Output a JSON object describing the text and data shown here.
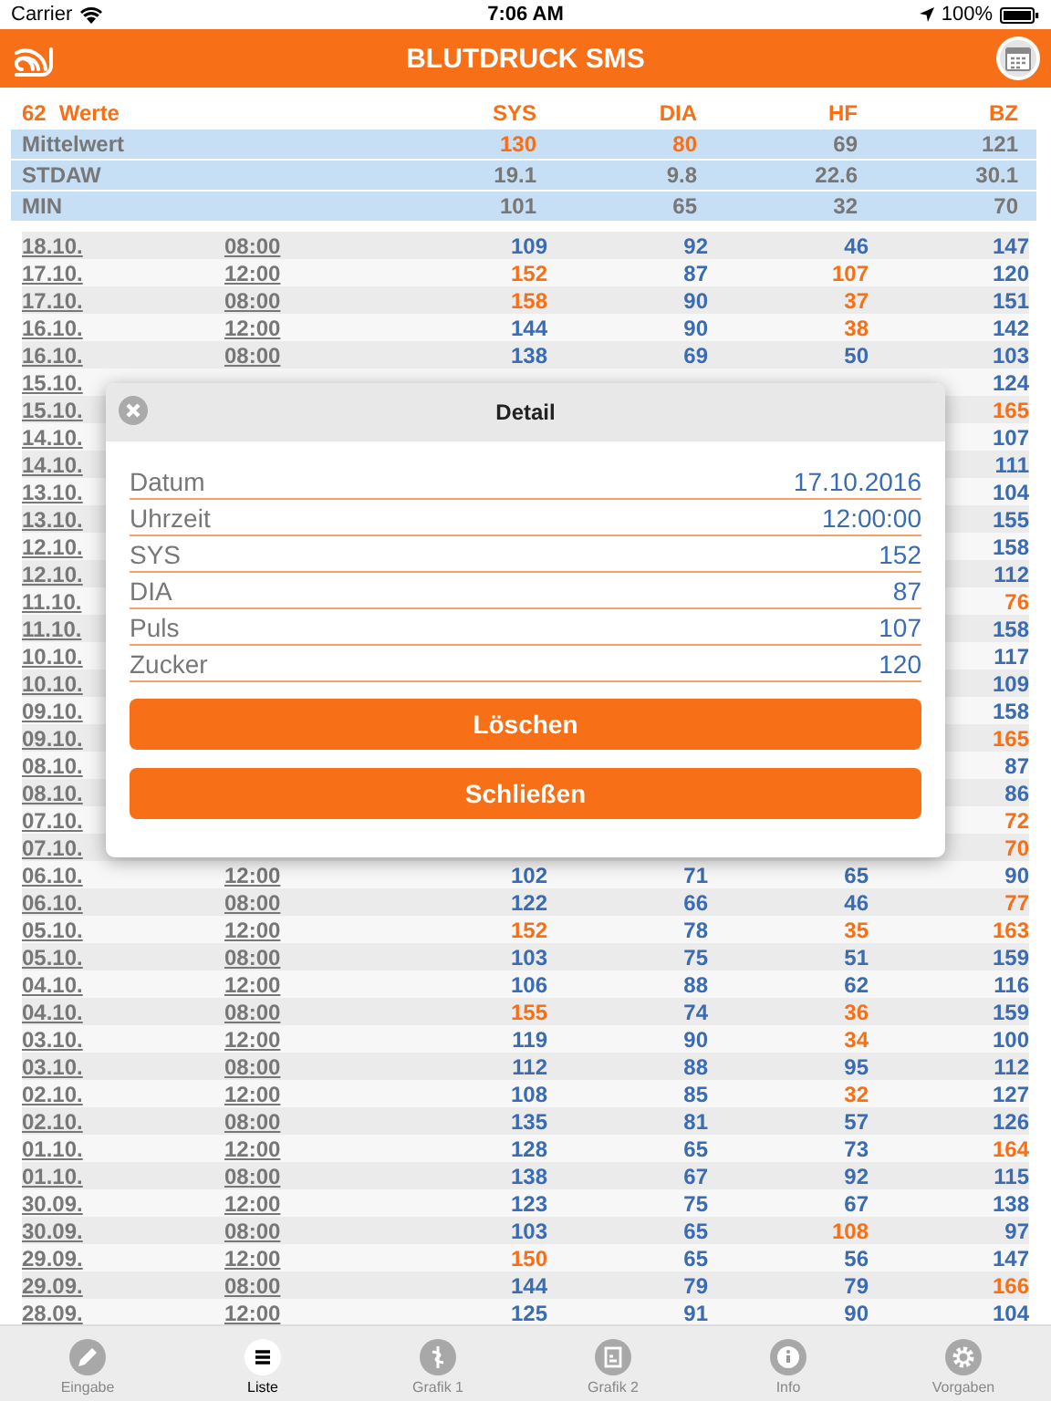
{
  "status_bar": {
    "carrier": "Carrier",
    "time": "7:06 AM",
    "battery": "100%"
  },
  "header": {
    "title": "BLUTDRUCK SMS"
  },
  "summary": {
    "count": "62",
    "count_label": "Werte",
    "columns": [
      "SYS",
      "DIA",
      "HF",
      "BZ"
    ],
    "rows": [
      {
        "label": "Mittelwert",
        "sys": {
          "text": "130",
          "alert": true
        },
        "dia": {
          "text": "80",
          "alert": true
        },
        "hf": {
          "text": "69",
          "alert": false
        },
        "bz": {
          "text": "121",
          "alert": false
        }
      },
      {
        "label": "STDAW",
        "sys": {
          "text": "19.1",
          "alert": false
        },
        "dia": {
          "text": "9.8",
          "alert": false
        },
        "hf": {
          "text": "22.6",
          "alert": false
        },
        "bz": {
          "text": "30.1",
          "alert": false
        }
      },
      {
        "label": "MIN",
        "sys": {
          "text": "101",
          "alert": false
        },
        "dia": {
          "text": "65",
          "alert": false
        },
        "hf": {
          "text": "32",
          "alert": false
        },
        "bz": {
          "text": "70",
          "alert": false
        }
      }
    ]
  },
  "rows": [
    {
      "date": "18.10.",
      "time": "08:00",
      "sys": {
        "text": "109",
        "alert": false
      },
      "dia": {
        "text": "92",
        "alert": false
      },
      "hf": {
        "text": "46",
        "alert": false
      },
      "bz": {
        "text": "147",
        "alert": false
      }
    },
    {
      "date": "17.10.",
      "time": "12:00",
      "sys": {
        "text": "152",
        "alert": true
      },
      "dia": {
        "text": "87",
        "alert": false
      },
      "hf": {
        "text": "107",
        "alert": true
      },
      "bz": {
        "text": "120",
        "alert": false
      }
    },
    {
      "date": "17.10.",
      "time": "08:00",
      "sys": {
        "text": "158",
        "alert": true
      },
      "dia": {
        "text": "90",
        "alert": false
      },
      "hf": {
        "text": "37",
        "alert": true
      },
      "bz": {
        "text": "151",
        "alert": false
      }
    },
    {
      "date": "16.10.",
      "time": "12:00",
      "sys": {
        "text": "144",
        "alert": false
      },
      "dia": {
        "text": "90",
        "alert": false
      },
      "hf": {
        "text": "38",
        "alert": true
      },
      "bz": {
        "text": "142",
        "alert": false
      }
    },
    {
      "date": "16.10.",
      "time": "08:00",
      "sys": {
        "text": "138",
        "alert": false
      },
      "dia": {
        "text": "69",
        "alert": false
      },
      "hf": {
        "text": "50",
        "alert": false
      },
      "bz": {
        "text": "103",
        "alert": false
      }
    },
    {
      "date": "15.10.",
      "bz": {
        "text": "124",
        "alert": false
      }
    },
    {
      "date": "15.10.",
      "bz": {
        "text": "165",
        "alert": true
      }
    },
    {
      "date": "14.10.",
      "bz": {
        "text": "107",
        "alert": false
      }
    },
    {
      "date": "14.10.",
      "bz": {
        "text": "111",
        "alert": false
      }
    },
    {
      "date": "13.10.",
      "bz": {
        "text": "104",
        "alert": false
      }
    },
    {
      "date": "13.10.",
      "bz": {
        "text": "155",
        "alert": false
      }
    },
    {
      "date": "12.10.",
      "bz": {
        "text": "158",
        "alert": false
      }
    },
    {
      "date": "12.10.",
      "bz": {
        "text": "112",
        "alert": false
      }
    },
    {
      "date": "11.10.",
      "bz": {
        "text": "76",
        "alert": true
      }
    },
    {
      "date": "11.10.",
      "bz": {
        "text": "158",
        "alert": false
      }
    },
    {
      "date": "10.10.",
      "bz": {
        "text": "117",
        "alert": false
      }
    },
    {
      "date": "10.10.",
      "bz": {
        "text": "109",
        "alert": false
      }
    },
    {
      "date": "09.10.",
      "bz": {
        "text": "158",
        "alert": false
      }
    },
    {
      "date": "09.10.",
      "bz": {
        "text": "165",
        "alert": true
      }
    },
    {
      "date": "08.10.",
      "bz": {
        "text": "87",
        "alert": false
      }
    },
    {
      "date": "08.10.",
      "bz": {
        "text": "86",
        "alert": false
      }
    },
    {
      "date": "07.10.",
      "bz": {
        "text": "72",
        "alert": true
      }
    },
    {
      "date": "07.10.",
      "bz": {
        "text": "70",
        "alert": true
      }
    },
    {
      "date": "06.10.",
      "time": "12:00",
      "sys": {
        "text": "102",
        "alert": false
      },
      "dia": {
        "text": "71",
        "alert": false
      },
      "hf": {
        "text": "65",
        "alert": false
      },
      "bz": {
        "text": "90",
        "alert": false
      }
    },
    {
      "date": "06.10.",
      "time": "08:00",
      "sys": {
        "text": "122",
        "alert": false
      },
      "dia": {
        "text": "66",
        "alert": false
      },
      "hf": {
        "text": "46",
        "alert": false
      },
      "bz": {
        "text": "77",
        "alert": true
      }
    },
    {
      "date": "05.10.",
      "time": "12:00",
      "sys": {
        "text": "152",
        "alert": true
      },
      "dia": {
        "text": "78",
        "alert": false
      },
      "hf": {
        "text": "35",
        "alert": true
      },
      "bz": {
        "text": "163",
        "alert": true
      }
    },
    {
      "date": "05.10.",
      "time": "08:00",
      "sys": {
        "text": "103",
        "alert": false
      },
      "dia": {
        "text": "75",
        "alert": false
      },
      "hf": {
        "text": "51",
        "alert": false
      },
      "bz": {
        "text": "159",
        "alert": false
      }
    },
    {
      "date": "04.10.",
      "time": "12:00",
      "sys": {
        "text": "106",
        "alert": false
      },
      "dia": {
        "text": "88",
        "alert": false
      },
      "hf": {
        "text": "62",
        "alert": false
      },
      "bz": {
        "text": "116",
        "alert": false
      }
    },
    {
      "date": "04.10.",
      "time": "08:00",
      "sys": {
        "text": "155",
        "alert": true
      },
      "dia": {
        "text": "74",
        "alert": false
      },
      "hf": {
        "text": "36",
        "alert": true
      },
      "bz": {
        "text": "159",
        "alert": false
      }
    },
    {
      "date": "03.10.",
      "time": "12:00",
      "sys": {
        "text": "119",
        "alert": false
      },
      "dia": {
        "text": "90",
        "alert": false
      },
      "hf": {
        "text": "34",
        "alert": true
      },
      "bz": {
        "text": "100",
        "alert": false
      }
    },
    {
      "date": "03.10.",
      "time": "08:00",
      "sys": {
        "text": "112",
        "alert": false
      },
      "dia": {
        "text": "88",
        "alert": false
      },
      "hf": {
        "text": "95",
        "alert": false
      },
      "bz": {
        "text": "112",
        "alert": false
      }
    },
    {
      "date": "02.10.",
      "time": "12:00",
      "sys": {
        "text": "108",
        "alert": false
      },
      "dia": {
        "text": "85",
        "alert": false
      },
      "hf": {
        "text": "32",
        "alert": true
      },
      "bz": {
        "text": "127",
        "alert": false
      }
    },
    {
      "date": "02.10.",
      "time": "08:00",
      "sys": {
        "text": "135",
        "alert": false
      },
      "dia": {
        "text": "81",
        "alert": false
      },
      "hf": {
        "text": "57",
        "alert": false
      },
      "bz": {
        "text": "126",
        "alert": false
      }
    },
    {
      "date": "01.10.",
      "time": "12:00",
      "sys": {
        "text": "128",
        "alert": false
      },
      "dia": {
        "text": "65",
        "alert": false
      },
      "hf": {
        "text": "73",
        "alert": false
      },
      "bz": {
        "text": "164",
        "alert": true
      }
    },
    {
      "date": "01.10.",
      "time": "08:00",
      "sys": {
        "text": "138",
        "alert": false
      },
      "dia": {
        "text": "67",
        "alert": false
      },
      "hf": {
        "text": "92",
        "alert": false
      },
      "bz": {
        "text": "115",
        "alert": false
      }
    },
    {
      "date": "30.09.",
      "time": "12:00",
      "sys": {
        "text": "123",
        "alert": false
      },
      "dia": {
        "text": "75",
        "alert": false
      },
      "hf": {
        "text": "67",
        "alert": false
      },
      "bz": {
        "text": "138",
        "alert": false
      }
    },
    {
      "date": "30.09.",
      "time": "08:00",
      "sys": {
        "text": "103",
        "alert": false
      },
      "dia": {
        "text": "65",
        "alert": false
      },
      "hf": {
        "text": "108",
        "alert": true
      },
      "bz": {
        "text": "97",
        "alert": false
      }
    },
    {
      "date": "29.09.",
      "time": "12:00",
      "sys": {
        "text": "150",
        "alert": true
      },
      "dia": {
        "text": "65",
        "alert": false
      },
      "hf": {
        "text": "56",
        "alert": false
      },
      "bz": {
        "text": "147",
        "alert": false
      }
    },
    {
      "date": "29.09.",
      "time": "08:00",
      "sys": {
        "text": "144",
        "alert": false
      },
      "dia": {
        "text": "79",
        "alert": false
      },
      "hf": {
        "text": "79",
        "alert": false
      },
      "bz": {
        "text": "166",
        "alert": true
      }
    },
    {
      "date": "28.09.",
      "time": "12:00",
      "sys": {
        "text": "125",
        "alert": false
      },
      "dia": {
        "text": "91",
        "alert": false
      },
      "hf": {
        "text": "90",
        "alert": false
      },
      "bz": {
        "text": "104",
        "alert": false
      }
    }
  ],
  "dialog": {
    "title": "Detail",
    "fields": [
      {
        "label": "Datum",
        "value": "17.10.2016"
      },
      {
        "label": "Uhrzeit",
        "value": "12:00:00"
      },
      {
        "label": "SYS",
        "value": "152"
      },
      {
        "label": "DIA",
        "value": "87"
      },
      {
        "label": "Puls",
        "value": "107"
      },
      {
        "label": "Zucker",
        "value": "120"
      }
    ],
    "buttons": [
      "Löschen",
      "Schließen"
    ]
  },
  "tabs": [
    {
      "label": "Eingabe",
      "kind": "pencil",
      "selected": false
    },
    {
      "label": "Liste",
      "kind": "list",
      "selected": true
    },
    {
      "label": "Grafik 1",
      "kind": "graph1",
      "selected": false
    },
    {
      "label": "Grafik 2",
      "kind": "graph2",
      "selected": false
    },
    {
      "label": "Info",
      "kind": "info",
      "selected": false
    },
    {
      "label": "Vorgaben",
      "kind": "gear",
      "selected": false
    }
  ]
}
